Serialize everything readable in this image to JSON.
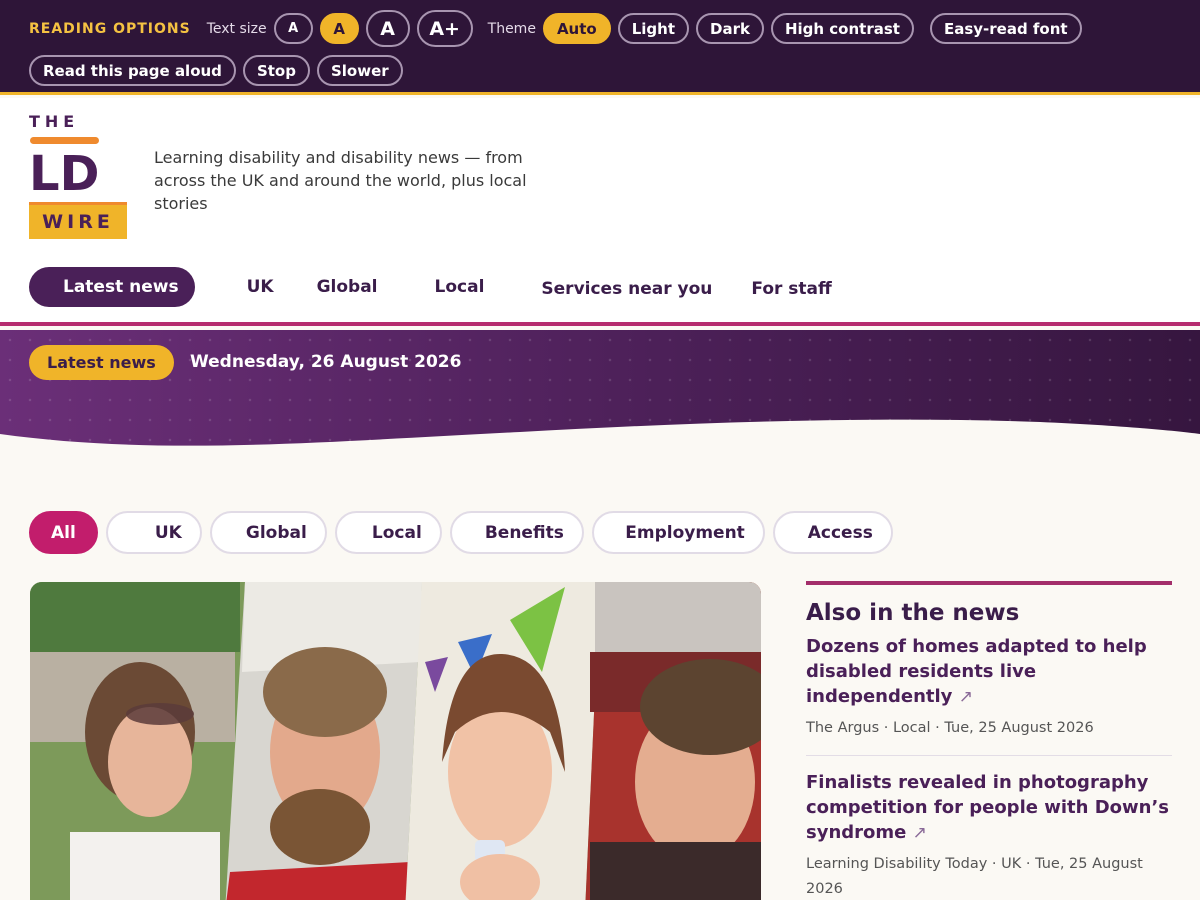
{
  "reading_options": {
    "title": "READING OPTIONS",
    "text_size_label": "Text size",
    "text_sizes": [
      "A",
      "A",
      "A",
      "A+"
    ],
    "theme_label": "Theme",
    "themes": [
      "Auto",
      "Light",
      "Dark",
      "High contrast"
    ],
    "easy_read": "Easy-read font",
    "read_aloud": "Read this page aloud",
    "stop": "Stop",
    "slower": "Slower"
  },
  "logo": {
    "the": "THE",
    "ld": "LD",
    "wire": "WIRE"
  },
  "tagline": "Learning disability and disability news — from across the UK and around the world, plus local stories",
  "nav": [
    "Latest news",
    "UK",
    "Global",
    "Local",
    "Services near you",
    "For staff"
  ],
  "banner": {
    "badge": "Latest news",
    "date": "Wednesday, 26 August 2026"
  },
  "filters": [
    "All",
    "UK",
    "Global",
    "Local",
    "Benefits",
    "Employment",
    "Access"
  ],
  "sidebar": {
    "title": "Also in the news",
    "stories": [
      {
        "headline": "Dozens of homes adapted to help disabled residents live independently",
        "arrow": "↗",
        "meta": "The Argus · Local · Tue, 25 August 2026"
      },
      {
        "headline": "Finalists revealed in photography competition for people with Down’s syndrome",
        "arrow": "↗",
        "meta": "Learning Disability Today · UK · Tue, 25 August 2026"
      }
    ]
  },
  "colors": {
    "brand_purple": "#4a2058",
    "accent_yellow": "#f0b429",
    "accent_magenta": "#c21d6c",
    "logo_orange": "#ef8a2e"
  }
}
